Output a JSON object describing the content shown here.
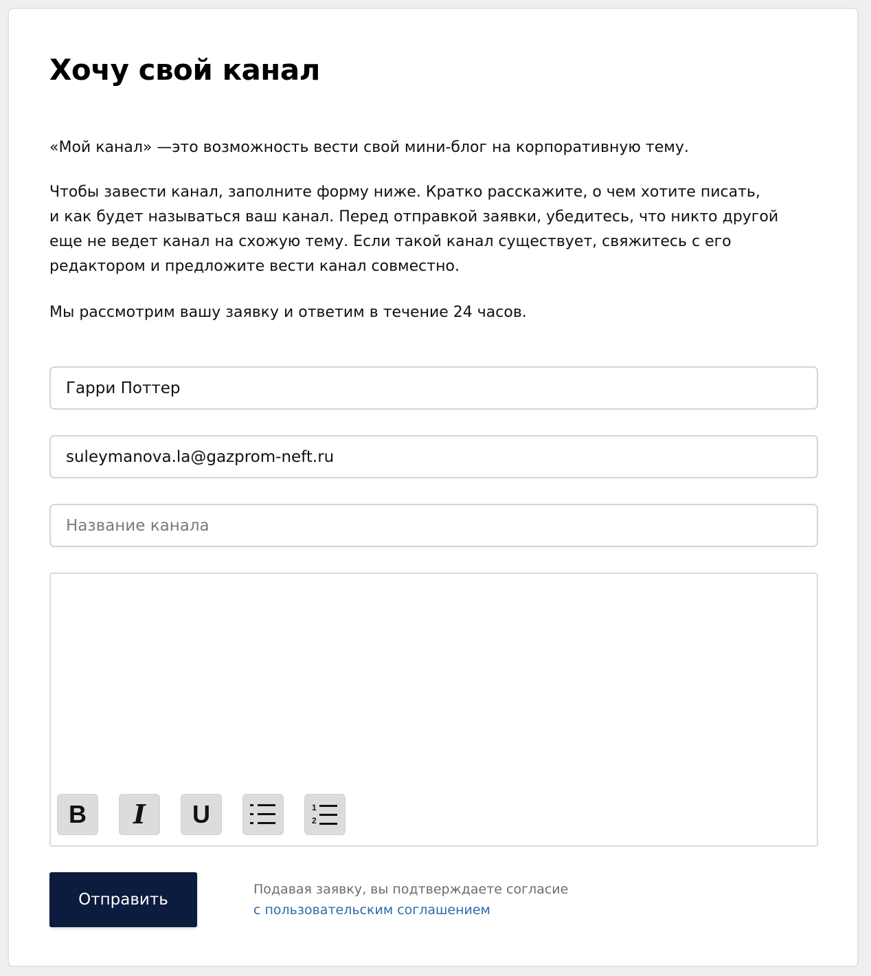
{
  "page": {
    "title": "Хочу свой канал"
  },
  "intro": {
    "paragraph1": "«Мой канал» —это возможность вести свой мини-блог на корпоративную тему.",
    "paragraph2_lines": [
      "Чтобы завести канал, заполните форму ниже. Кратко расскажите, о чем хотите писать,",
      "и как будет называться ваш канал. Перед отправкой заявки, убедитесь, что никто другой",
      "еще не ведет канал на схожую тему. Если такой канал существует, свяжитесь с его",
      "редактором и предложите вести канал совместно."
    ],
    "paragraph3": "Мы рассмотрим вашу заявку и ответим в течение 24 часов."
  },
  "form": {
    "name_value": "Гарри Поттер",
    "email_value": "suleymanova.la@gazprom-neft.ru",
    "channel_name_value": "",
    "channel_name_placeholder": "Название канала",
    "description_value": ""
  },
  "toolbar": {
    "bold_label": "B",
    "italic_label": "I",
    "underline_label": "U",
    "bullet_list_icon": "bullet-list-icon",
    "numbered_list_icon": "numbered-list-icon"
  },
  "actions": {
    "submit_label": "Отправить",
    "consent_text": "Подавая заявку, вы подтверждаете согласие",
    "consent_link": "с пользовательским соглашением"
  },
  "colors": {
    "submit_bg": "#0c1c3e",
    "link": "#2f6aa9",
    "toolbar_button_bg": "#dcdcdc"
  }
}
